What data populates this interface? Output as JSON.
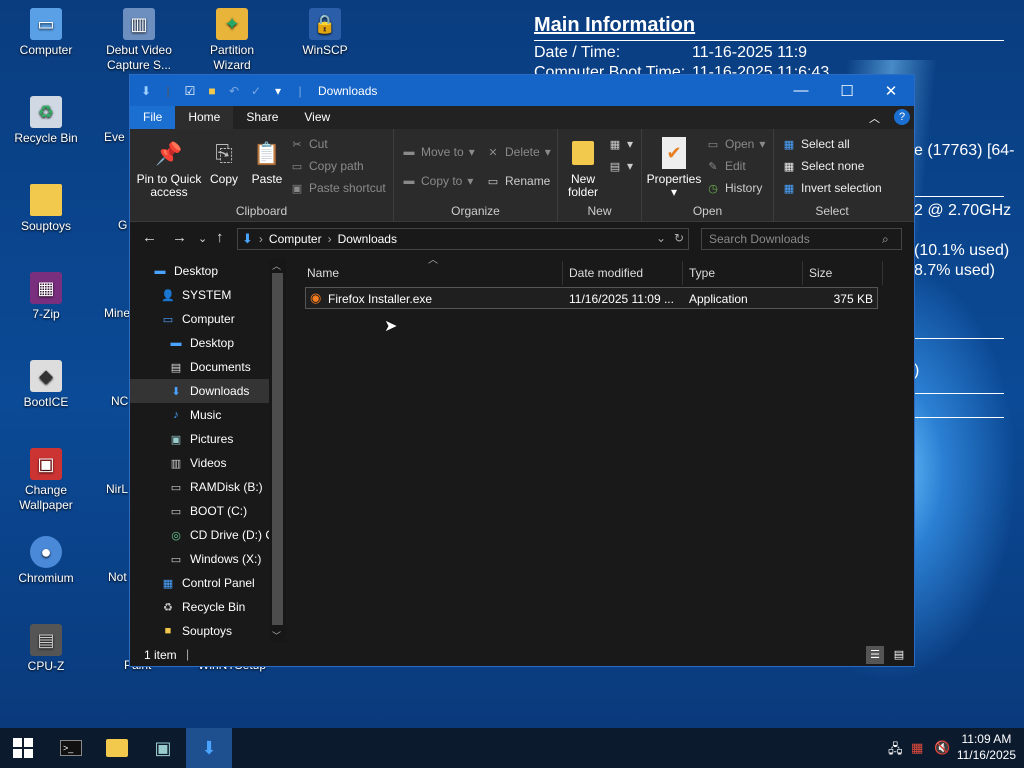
{
  "desktop": {
    "icons": [
      {
        "label": "Computer"
      },
      {
        "label": "Recycle Bin"
      },
      {
        "label": "Souptoys"
      },
      {
        "label": "7-Zip"
      },
      {
        "label": "BootICE"
      },
      {
        "label": "Change Wallpaper"
      },
      {
        "label": "Chromium"
      },
      {
        "label": "CPU-Z"
      },
      {
        "label": "Debut Video Capture S..."
      },
      {
        "label": "Partition Wizard"
      },
      {
        "label": "WinSCP"
      }
    ],
    "partial_labels": [
      "Eve",
      "G",
      "Mine",
      "NC",
      "NirL",
      "Not",
      "Paint",
      "WinNTSetup"
    ]
  },
  "info": {
    "title": "Main Information",
    "rows": [
      {
        "key": "Date / Time:",
        "value": "11-16-2025 11:9"
      },
      {
        "key": "Computer Boot Time:",
        "value": "11-16-2025 11:6:43"
      }
    ],
    "frags": [
      "e (17763) [64-",
      "2 @ 2.70GHz",
      "(10.1% used)",
      "8.7% used)",
      ")"
    ]
  },
  "explorer": {
    "title": "Downloads",
    "tabs": [
      "File",
      "Home",
      "Share",
      "View"
    ],
    "ribbon": {
      "pin": "Pin to Quick access",
      "copy": "Copy",
      "paste": "Paste",
      "cut": "Cut",
      "copy_path": "Copy path",
      "paste_shortcut": "Paste shortcut",
      "clipboard": "Clipboard",
      "move_to": "Move to",
      "copy_to": "Copy to",
      "delete": "Delete",
      "rename": "Rename",
      "organize": "Organize",
      "new_folder": "New folder",
      "new": "New",
      "properties": "Properties",
      "open": "Open",
      "edit": "Edit",
      "history": "History",
      "open_group": "Open",
      "select_all": "Select all",
      "select_none": "Select none",
      "invert_selection": "Invert selection",
      "select": "Select"
    },
    "address": {
      "parts": [
        "Computer",
        "Downloads"
      ],
      "search_placeholder": "Search Downloads"
    },
    "nav": [
      {
        "label": "Desktop",
        "level": 0
      },
      {
        "label": "SYSTEM",
        "level": 1
      },
      {
        "label": "Computer",
        "level": 1
      },
      {
        "label": "Desktop",
        "level": 2
      },
      {
        "label": "Documents",
        "level": 2
      },
      {
        "label": "Downloads",
        "level": 2,
        "selected": true
      },
      {
        "label": "Music",
        "level": 2
      },
      {
        "label": "Pictures",
        "level": 2
      },
      {
        "label": "Videos",
        "level": 2
      },
      {
        "label": "RAMDisk (B:)",
        "level": 2
      },
      {
        "label": "BOOT (C:)",
        "level": 2
      },
      {
        "label": "CD Drive (D:) C",
        "level": 2
      },
      {
        "label": "Windows (X:)",
        "level": 2
      },
      {
        "label": "Control Panel",
        "level": 1
      },
      {
        "label": "Recycle Bin",
        "level": 1
      },
      {
        "label": "Souptoys",
        "level": 1
      }
    ],
    "columns": [
      "Name",
      "Date modified",
      "Type",
      "Size"
    ],
    "files": [
      {
        "name": "Firefox Installer.exe",
        "date": "11/16/2025 11:09 ...",
        "type": "Application",
        "size": "375 KB"
      }
    ],
    "status": "1 item"
  },
  "taskbar": {
    "time": "11:09 AM",
    "date": "11/16/2025"
  }
}
